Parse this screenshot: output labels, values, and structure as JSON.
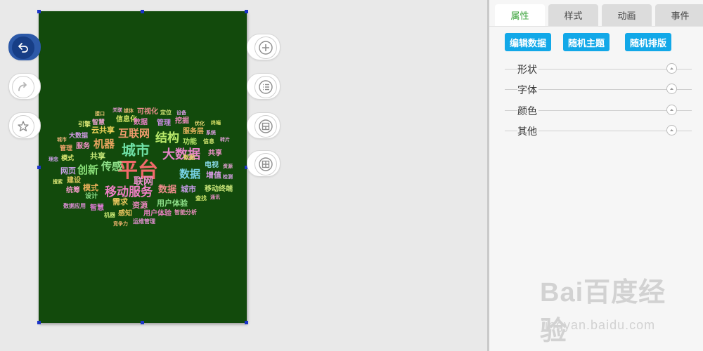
{
  "tabs": [
    {
      "label": "属性",
      "active": true
    },
    {
      "label": "样式",
      "active": false
    },
    {
      "label": "动画",
      "active": false
    },
    {
      "label": "事件",
      "active": false
    }
  ],
  "actions": {
    "edit_data": "编辑数据",
    "random_theme": "随机主题",
    "random_layout": "随机排版"
  },
  "sections": [
    "形状",
    "字体",
    "颜色",
    "其他"
  ],
  "tools_left": [
    {
      "icon": "undo-icon",
      "active": true
    },
    {
      "icon": "redo-icon",
      "active": false
    },
    {
      "icon": "star-icon",
      "active": false
    }
  ],
  "tools_right": [
    {
      "icon": "plus-icon"
    },
    {
      "icon": "list-icon"
    },
    {
      "icon": "layout-icon"
    },
    {
      "icon": "grid-icon"
    }
  ],
  "watermark": {
    "main": "Bai百度经验",
    "sub": "jingyan.baidu.com"
  },
  "colors": {
    "poster_bg": "#124a0c",
    "accent": "#12a8e8",
    "tab_active": "#3aa33a",
    "tool_active": "#2c59a8"
  },
  "wordcloud": {
    "words": [
      {
        "text": "平台",
        "color": "#f06a6a"
      },
      {
        "text": "城市",
        "color": "#6fe0a6"
      },
      {
        "text": "大数据",
        "color": "#e784c8"
      },
      {
        "text": "移动服务",
        "color": "#ee7fc4"
      },
      {
        "text": "互联网",
        "color": "#ef9b6e"
      },
      {
        "text": "结构",
        "color": "#b8e86a"
      },
      {
        "text": "机器",
        "color": "#e5a35e"
      },
      {
        "text": "数据",
        "color": "#78d4e8"
      },
      {
        "text": "创新",
        "color": "#8be17a"
      },
      {
        "text": "云共享",
        "color": "#f0d45a"
      },
      {
        "text": "共享",
        "color": "#c6e878"
      },
      {
        "text": "模式",
        "color": "#e8b05a"
      },
      {
        "text": "需求",
        "color": "#e9c75e"
      },
      {
        "text": "资源",
        "color": "#ed87c0"
      },
      {
        "text": "用户体验",
        "color": "#8ee08a"
      },
      {
        "text": "智慧",
        "color": "#d97ad0"
      },
      {
        "text": "用户体验",
        "color": "#e57fbe"
      },
      {
        "text": "网页",
        "color": "#c8a1e6"
      },
      {
        "text": "信息化",
        "color": "#d8e868"
      },
      {
        "text": "可视化",
        "color": "#ef8f8f"
      },
      {
        "text": "管理",
        "color": "#c78be0"
      },
      {
        "text": "挖掘",
        "color": "#e889b8"
      },
      {
        "text": "数据",
        "color": "#e37ec0"
      },
      {
        "text": "服务层",
        "color": "#e6b35e"
      },
      {
        "text": "功能",
        "color": "#b8e66a"
      },
      {
        "text": "增值",
        "color": "#d79be4"
      },
      {
        "text": "电视",
        "color": "#88d9e8"
      },
      {
        "text": "城市",
        "color": "#c49ae4"
      },
      {
        "text": "设计",
        "color": "#8fe08c"
      },
      {
        "text": "建设",
        "color": "#e0ca62"
      },
      {
        "text": "统筹",
        "color": "#ef98c6"
      },
      {
        "text": "服务",
        "color": "#ee8ec4"
      },
      {
        "text": "大数据",
        "color": "#d49be6"
      },
      {
        "text": "管理",
        "color": "#f0a36c"
      },
      {
        "text": "模式",
        "color": "#d8e470"
      },
      {
        "text": "感知",
        "color": "#e6c25e"
      },
      {
        "text": "运维管理",
        "color": "#e18fd0"
      },
      {
        "text": "竞争力",
        "color": "#e8b06a"
      },
      {
        "text": "智能分析",
        "color": "#ee8fc0"
      },
      {
        "text": "机器",
        "color": "#c9e874"
      },
      {
        "text": "数据应用",
        "color": "#dd8fd8"
      },
      {
        "text": "查找",
        "color": "#d2e86e"
      },
      {
        "text": "通讯",
        "color": "#e890c4"
      },
      {
        "text": "移动终端",
        "color": "#c8e478"
      },
      {
        "text": "检测",
        "color": "#d8a0e8"
      },
      {
        "text": "资源",
        "color": "#e6a3d6"
      },
      {
        "text": "数据",
        "color": "#e6d66a"
      },
      {
        "text": "共享",
        "color": "#ef93c9"
      },
      {
        "text": "转片",
        "color": "#e7a2dd"
      },
      {
        "text": "信息",
        "color": "#d6e872"
      },
      {
        "text": "系统",
        "color": "#e3a0e8"
      },
      {
        "text": "优化",
        "color": "#e8d874"
      },
      {
        "text": "设备",
        "color": "#d59be2"
      },
      {
        "text": "定位",
        "color": "#d9e878"
      },
      {
        "text": "媒体",
        "color": "#e9b774"
      },
      {
        "text": "关联",
        "color": "#e89bd6"
      },
      {
        "text": "接口",
        "color": "#f0c877"
      },
      {
        "text": "引擎",
        "color": "#d8e474"
      },
      {
        "text": "智慧",
        "color": "#e8a0cc"
      },
      {
        "text": "城市",
        "color": "#e6b076"
      },
      {
        "text": "搜索",
        "color": "#d7e474"
      },
      {
        "text": "理念",
        "color": "#c99de6"
      },
      {
        "text": "联网",
        "color": "#e98ecb"
      },
      {
        "text": "数据",
        "color": "#ef8c8c"
      },
      {
        "text": "传感",
        "color": "#8fe08a"
      },
      {
        "text": "终端",
        "color": "#d8e266"
      }
    ]
  }
}
